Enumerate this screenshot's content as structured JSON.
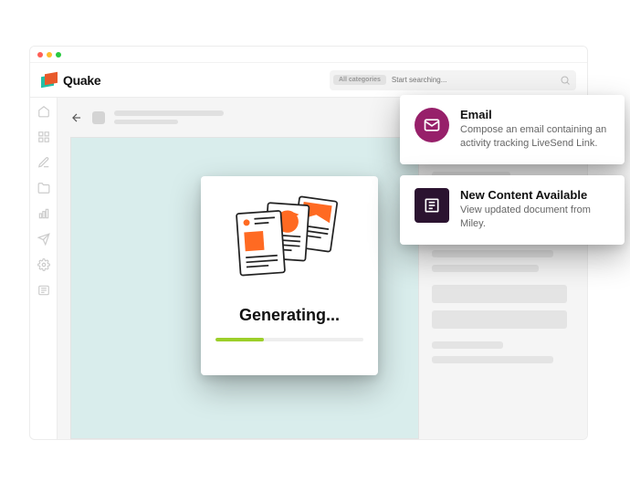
{
  "brand": {
    "name": "Quake"
  },
  "search": {
    "tag": "All categories",
    "placeholder": "Start searching..."
  },
  "generating": {
    "label": "Generating...",
    "progress_pct": 33
  },
  "toasts": {
    "email": {
      "title": "Email",
      "body": "Compose an email containing an activity tracking LiveSend Link."
    },
    "content": {
      "title": "New Content Available",
      "body": "View updated document from Miley."
    }
  }
}
